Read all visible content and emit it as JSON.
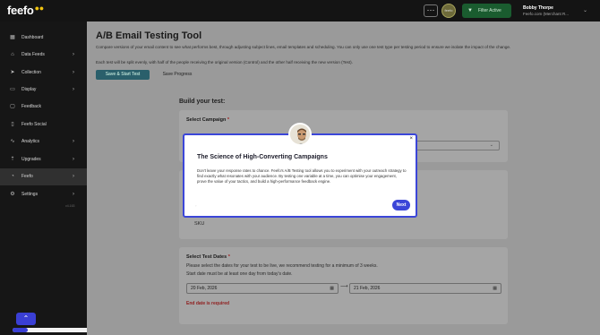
{
  "topbar": {
    "logo": "feefo",
    "logo_dots": "●●",
    "menu_icon": "⋯",
    "avatar_text": "feefo",
    "filter_label": "Filter Active",
    "filter_icon": "funnel-icon",
    "user_name": "Bobby Thorpe",
    "user_company": "Feefo.com (Merchant R...",
    "user_caret": "⌄"
  },
  "sidebar": {
    "items": [
      {
        "label": "Dashboard",
        "icon": "▦",
        "arrow": ""
      },
      {
        "label": "Data Feeds",
        "icon": "⌂",
        "arrow": "›"
      },
      {
        "label": "Collection",
        "icon": "➤",
        "arrow": "›"
      },
      {
        "label": "Display",
        "icon": "▭",
        "arrow": "›"
      },
      {
        "label": "Feedback",
        "icon": "▢",
        "arrow": ""
      },
      {
        "label": "Feefo Social",
        "icon": "▯",
        "arrow": ""
      },
      {
        "label": "Analytics",
        "icon": "∿",
        "arrow": "›"
      },
      {
        "label": "Upgrades",
        "icon": "⇡",
        "arrow": "›"
      },
      {
        "label": "Feefo",
        "icon": "◔",
        "arrow": "›"
      },
      {
        "label": "Settings",
        "icon": "⚙",
        "arrow": "›"
      }
    ],
    "active_index": 8,
    "version": "v4.163",
    "scroll_top_icon": "⌃",
    "progress": 0.12
  },
  "main": {
    "title": "A/B Email Testing Tool",
    "desc1": "Compare versions of your email content to see what performs best, through adjusting subject lines, email templates and scheduling. You can only use one test type per testing period to ensure we isolate the impact of the change.",
    "desc2": "Each test will be split evenly, with half of the people receiving the original version (Control) and the other half receiving the new version (Test).",
    "start_button": "Save & Start Test",
    "save_button": "Save Progress",
    "build_title": "Build your test:",
    "campaign_title": "Select Campaign",
    "required_mark": "*",
    "select_caret": "⌄",
    "sku_label": "SKU",
    "dates_title": "Select Test Dates",
    "dates_text1": "Please select the dates for your test to be live, we recommend testing for a minimum of 3 weeks.",
    "dates_text2": "Start date must be at least one day from today's date.",
    "start_date": "20 Feb, 2026",
    "end_date": "21 Feb, 2026",
    "date_arrow": "⟶",
    "calendar_icon": "▦",
    "date_error": "End date is required"
  },
  "modal": {
    "title": "The Science of High-Converting Campaigns",
    "body": "Don't leave your response rates to chance. Feefo's A/B Testing tool allows you to experiment with your outreach strategy to find exactly what resonates with your audience. By testing one variable at a time, you can optimise your engagement, prove the value of your tactics, and build a high-performance feedback engine.",
    "next_label": "Next",
    "close_icon": "×",
    "step_marker": "◦"
  },
  "colors": {
    "accent": "#3b46d8",
    "sidebar_bg": "#161616",
    "filter_green": "#1a5c2f",
    "error_red": "#8f1c1c"
  }
}
